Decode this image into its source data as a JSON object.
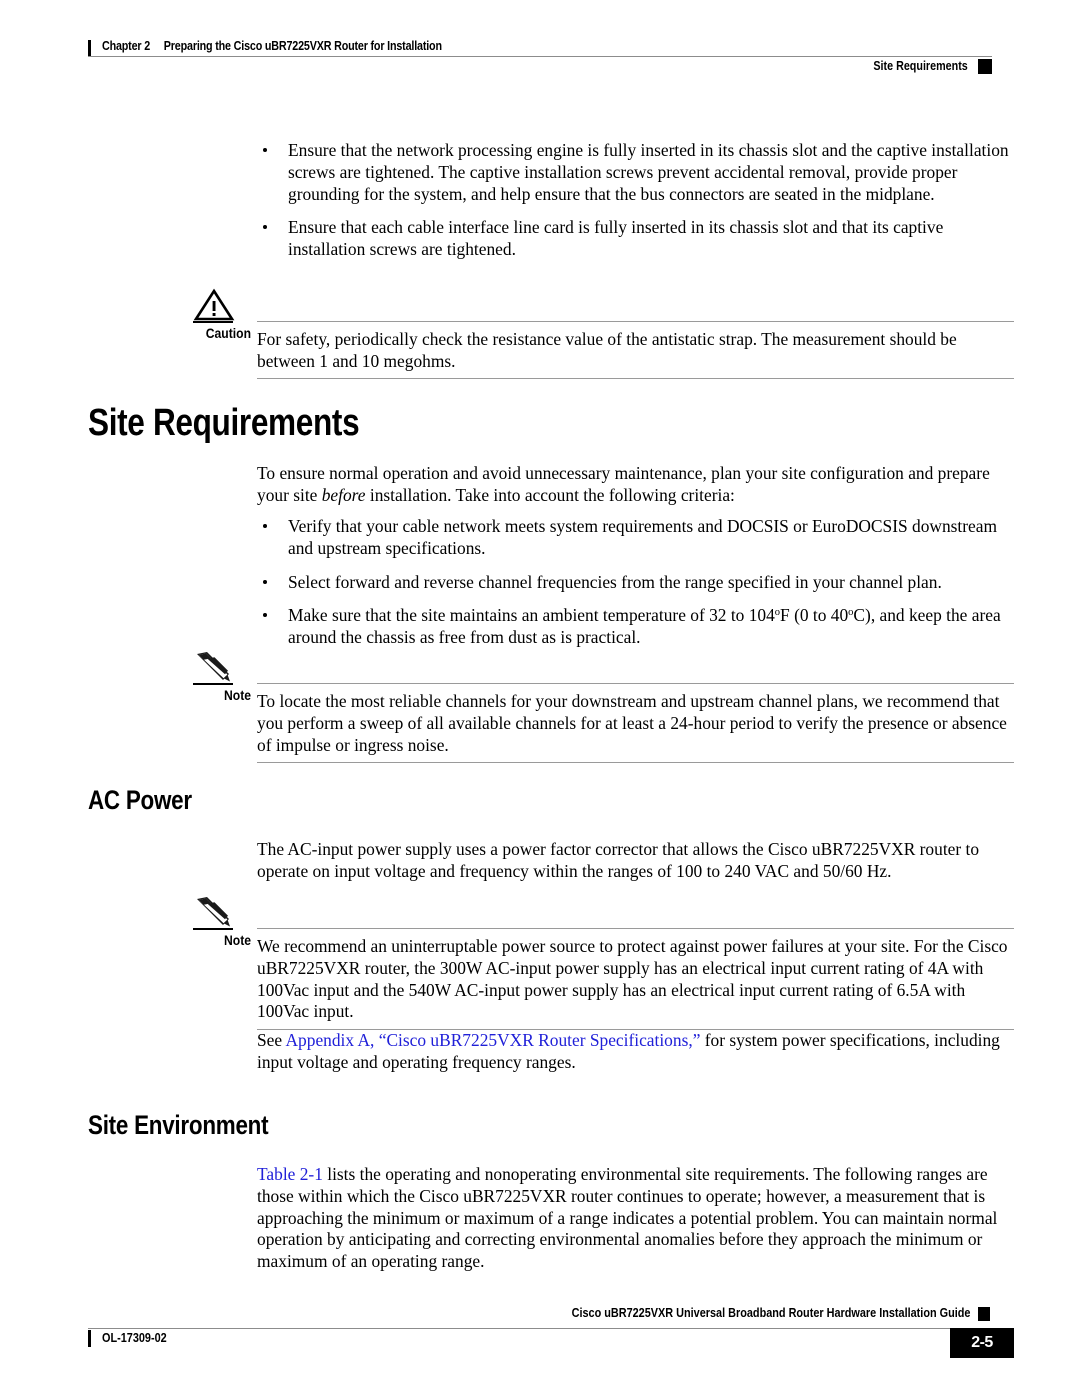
{
  "header": {
    "chapter_number": "Chapter 2",
    "chapter_title": "Preparing the Cisco uBR7225VXR Router for Installation",
    "running_head": "Site Requirements"
  },
  "intro_bullets": [
    "Ensure that the network processing engine is fully inserted in its chassis slot and the captive installation screws are tightened. The captive installation screws prevent accidental removal, provide proper grounding for the system, and help ensure that the bus connectors are seated in the midplane.",
    "Ensure that each cable interface line card is fully inserted in its chassis slot and that its captive installation screws are tightened."
  ],
  "caution": {
    "label": "Caution",
    "icon": "warning-triangle-icon",
    "text": "For safety, periodically check the resistance value of the antistatic strap. The measurement should be between 1 and 10 megohms."
  },
  "site_requirements": {
    "heading": "Site Requirements",
    "intro_part1": "To ensure normal operation and avoid unnecessary maintenance, plan your site configuration and prepare your site ",
    "intro_italic": "before",
    "intro_part2": " installation. Take into account the following criteria:",
    "bullets": [
      {
        "text": "Verify that your cable network meets system requirements and DOCSIS or EuroDOCSIS downstream and upstream specifications."
      },
      {
        "text": "Select forward and reverse channel frequencies from the range specified in your channel plan."
      },
      {
        "pre": "Make sure that the site maintains an ambient temperature of 32 to 104",
        "deg1": "o",
        "mid": "F (0 to 40",
        "deg2": "o",
        "post": "C), and keep the area around the chassis as free from dust as is practical."
      }
    ],
    "note": {
      "label": "Note",
      "icon": "pencil-icon",
      "text": "To locate the most reliable channels for your downstream and upstream channel plans, we recommend that you perform a sweep of all available channels for at least a 24-hour period to verify the presence or absence of impulse or ingress noise."
    }
  },
  "ac_power": {
    "heading": "AC Power",
    "paragraph": "The AC-input power supply uses a power factor corrector that allows the Cisco uBR7225VXR router to operate on input voltage and frequency within the ranges of 100 to 240 VAC and 50/60 Hz.",
    "note": {
      "label": "Note",
      "icon": "pencil-icon",
      "text": "We recommend an uninterruptable power source to protect against power failures at your site. For the Cisco uBR7225VXR router, the 300W AC-input power supply has an electrical input current rating of 4A with 100Vac input and the 540W AC-input power supply has an electrical input current rating of 6.5A with 100Vac input."
    },
    "see_pre": "See ",
    "see_link": "Appendix A, “Cisco uBR7225VXR Router Specifications,”",
    "see_post": " for system power specifications, including input voltage and operating frequency ranges."
  },
  "site_environment": {
    "heading": "Site Environment",
    "link": "Table 2-1",
    "paragraph": " lists the operating and nonoperating environmental site requirements. The following ranges are those within which the Cisco uBR7225VXR router continues to operate; however, a measurement that is approaching the minimum or maximum of a range indicates a potential problem. You can maintain normal operation by anticipating and correcting environmental anomalies before they approach the minimum or maximum of an operating range."
  },
  "footer": {
    "guide_title": "Cisco uBR7225VXR Universal Broadband Router Hardware Installation Guide",
    "doc_id": "OL-17309-02",
    "page_number": "2-5"
  },
  "colors": {
    "link": "#2020d8",
    "rule": "#8c8c8c",
    "text": "#000000"
  }
}
